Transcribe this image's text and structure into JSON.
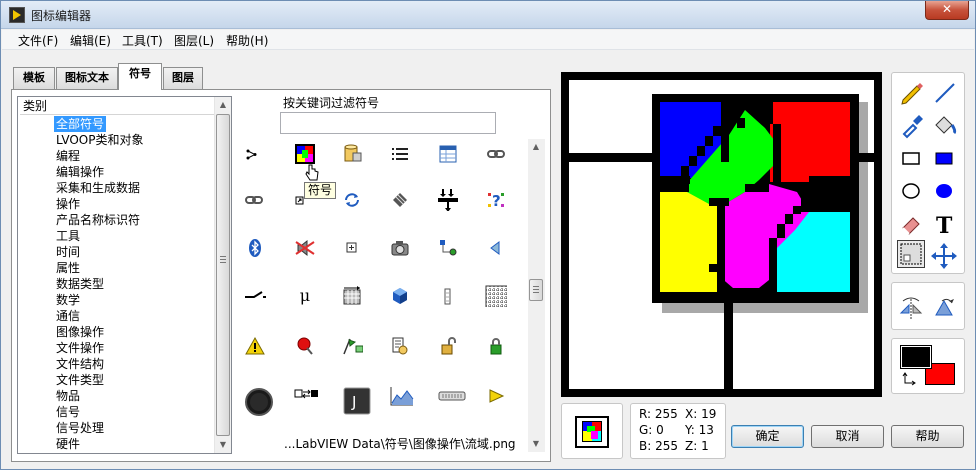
{
  "window": {
    "title": "图标编辑器",
    "close": "✕"
  },
  "menu": [
    "文件(F)",
    "编辑(E)",
    "工具(T)",
    "图层(L)",
    "帮助(H)"
  ],
  "tabs": [
    "模板",
    "图标文本",
    "符号",
    "图层"
  ],
  "active_tab": "符号",
  "categories": {
    "header": "类别",
    "selected": "全部符号",
    "items": [
      "全部符号",
      "LVOOP类和对象",
      "编程",
      "编辑操作",
      "采集和生成数据",
      "操作",
      "产品名称标识符",
      "工具",
      "时间",
      "属性",
      "数据类型",
      "数学",
      "通信",
      "图像操作",
      "文件操作",
      "文件结构",
      "文件类型",
      "物品",
      "信号",
      "信号处理",
      "硬件"
    ]
  },
  "filter": {
    "label": "按关键词过滤符号",
    "value": ""
  },
  "glyph_icons": [
    "node-icon",
    "color-grid-icon",
    "database-icon",
    "list-icon",
    "table-icon",
    "chain-icon",
    "link-icon",
    "arrow-out-icon",
    "refresh-icon",
    "diamond-stripes-icon",
    "merge-icon",
    "question-icon",
    "bluetooth-icon",
    "speaker-mute-icon",
    "plus-box-icon",
    "camera-icon",
    "probe-icon",
    "speaker-icon",
    "switch-icon",
    "mu-icon",
    "grid-arrow-icon",
    "cube-icon",
    "column-icon",
    "grid-icon",
    "warning-icon",
    "pushpin-icon",
    "flags-icon",
    "document-gear-icon",
    "unlock-icon",
    "lock-icon",
    "knob-icon",
    "swap-icon",
    "j-key-icon",
    "chart-icon",
    "keyboard-icon",
    "play-icon"
  ],
  "tooltip": "符号",
  "path": "...LabVIEW Data\\符号\\图像操作\\流域.png",
  "canvas": {
    "colors": {
      "blue": "#0000ff",
      "green": "#00ff00",
      "red": "#ff0000",
      "yellow": "#ffff00",
      "magenta": "#ff00ff",
      "cyan": "#00ffff",
      "shadow": "#a8a8a8"
    }
  },
  "tools": [
    "pencil-icon",
    "line-icon",
    "dropper-icon",
    "fill-icon",
    "rectangle-icon",
    "filled-rectangle-icon",
    "ellipse-icon",
    "filled-ellipse-icon",
    "eraser-icon",
    "text-icon",
    "select-icon",
    "move-icon"
  ],
  "flip_tools": [
    "flip-horizontal-icon",
    "flip-vertical-icon"
  ],
  "colors": {
    "foreground": "#000000",
    "background": "#ff0000"
  },
  "status": {
    "r": "R: 255",
    "g": "G: 0",
    "b": "B: 255",
    "x": "X: 19",
    "y": "Y: 13",
    "z": "Z: 1"
  },
  "buttons": {
    "ok": "确定",
    "cancel": "取消",
    "help": "帮助"
  }
}
